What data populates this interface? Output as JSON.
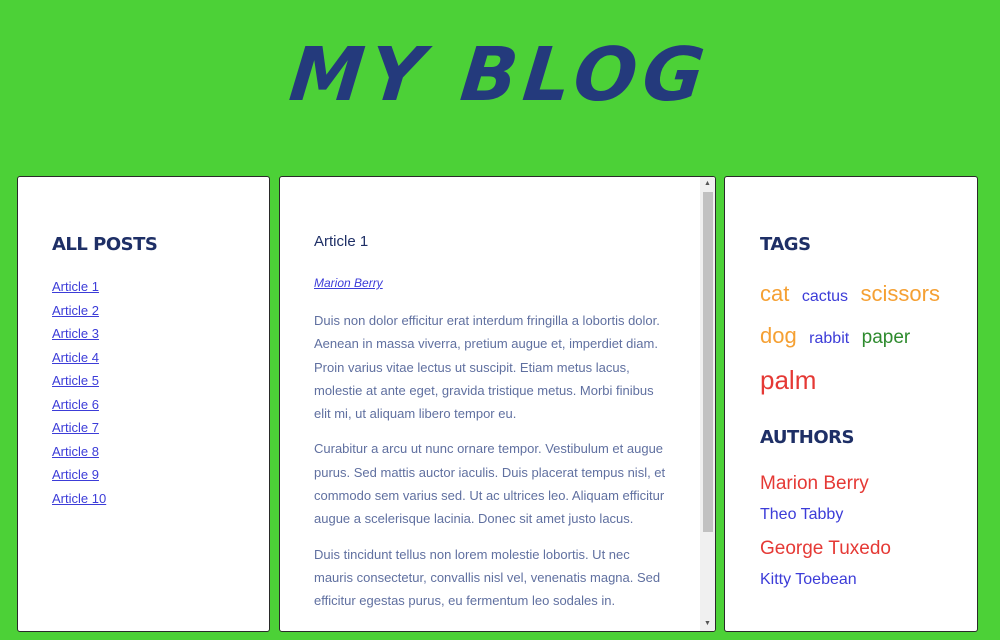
{
  "header": {
    "title": "MY BLOG"
  },
  "posts": {
    "heading": "ALL POSTS",
    "items": [
      "Article 1",
      "Article 2",
      "Article 3",
      "Article 4",
      "Article 5",
      "Article 6",
      "Article 7",
      "Article 8",
      "Article 9",
      "Article 10"
    ]
  },
  "article": {
    "title": "Article 1",
    "author": "Marion Berry",
    "paragraphs": [
      "Duis non dolor efficitur erat interdum fringilla a lobortis dolor. Aenean in massa viverra, pretium augue et, imperdiet diam. Proin varius vitae lectus ut suscipit. Etiam metus lacus, molestie at ante eget, gravida tristique metus. Morbi finibus elit mi, ut aliquam libero tempor eu.",
      "Curabitur a arcu ut nunc ornare tempor. Vestibulum et augue purus. Sed mattis auctor iaculis. Duis placerat tempus nisl, et commodo sem varius sed. Ut ac ultrices leo. Aliquam efficitur augue a scelerisque lacinia. Donec sit amet justo lacus.",
      "Duis tincidunt tellus non lorem molestie lobortis. Ut nec mauris consectetur, convallis nisl vel, venenatis magna. Sed efficitur egestas purus, eu fermentum leo sodales in."
    ]
  },
  "tags": {
    "heading": "TAGS",
    "items": [
      {
        "label": "cat",
        "color": "#f5a033"
      },
      {
        "label": "cactus",
        "color": "#3c3cd8"
      },
      {
        "label": "scissors",
        "color": "#f5a033"
      },
      {
        "label": "dog",
        "color": "#f5a033"
      },
      {
        "label": "rabbit",
        "color": "#3c3cd8"
      },
      {
        "label": "paper",
        "color": "#2e8b2e"
      },
      {
        "label": "palm",
        "color": "#e53935"
      }
    ]
  },
  "authors": {
    "heading": "AUTHORS",
    "items": [
      {
        "name": "Marion Berry",
        "color": "#e53935"
      },
      {
        "name": "Theo Tabby",
        "color": "#3c3cd8"
      },
      {
        "name": "George Tuxedo",
        "color": "#e53935"
      },
      {
        "name": "Kitty Toebean",
        "color": "#3c3cd8"
      }
    ]
  },
  "icons": {
    "scroll_up": "triangle-up",
    "scroll_down": "triangle-down"
  }
}
